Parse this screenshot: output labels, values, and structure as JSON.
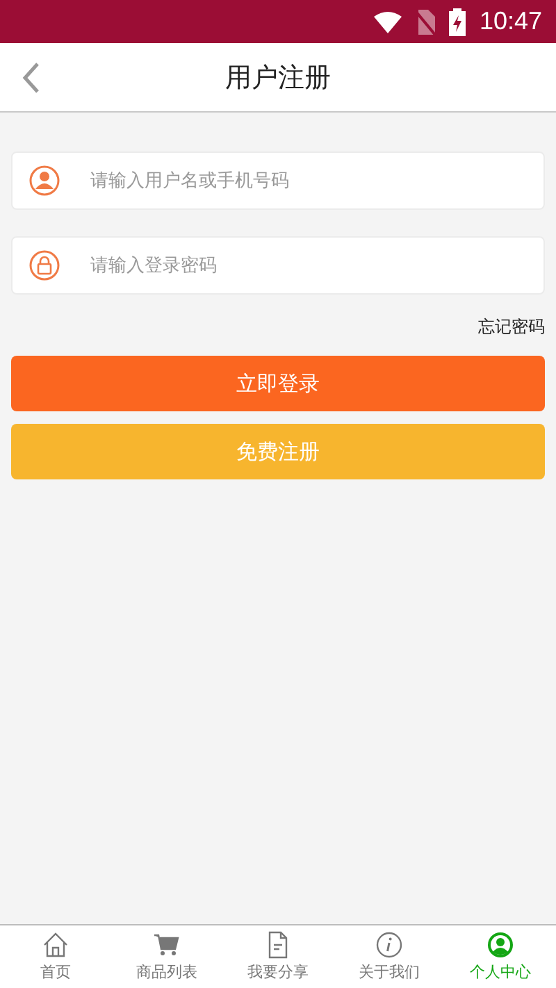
{
  "status_bar": {
    "time": "10:47"
  },
  "header": {
    "title": "用户注册"
  },
  "fields": [
    {
      "kind": "user",
      "placeholder": "请输入用户名或手机号码"
    },
    {
      "kind": "lock",
      "placeholder": "请输入登录密码"
    }
  ],
  "forgot_link": "忘记密码",
  "buttons": [
    {
      "kind": "primary",
      "label": "立即登录"
    },
    {
      "kind": "secondary",
      "label": "免费注册"
    }
  ],
  "tabs": [
    {
      "kind": "home",
      "label": "首页",
      "selected": false
    },
    {
      "kind": "cart",
      "label": "商品列表",
      "selected": false
    },
    {
      "kind": "document",
      "label": "我要分享",
      "selected": false
    },
    {
      "kind": "info",
      "label": "关于我们",
      "selected": false
    },
    {
      "kind": "person",
      "label": "个人中心",
      "selected": true
    }
  ]
}
